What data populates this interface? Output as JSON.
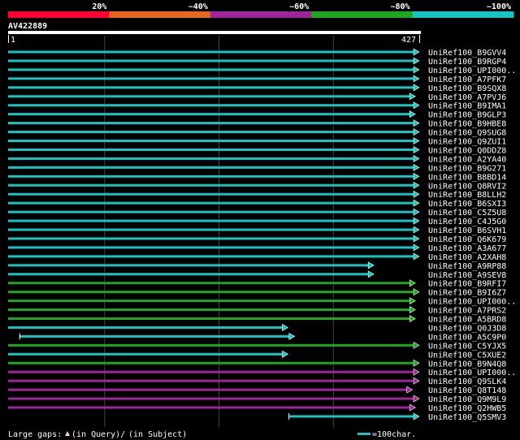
{
  "query": {
    "name": "AV422889",
    "start_label": "1",
    "end_label": "427",
    "length": 427
  },
  "identity_legend": {
    "ticks": [
      "20%",
      "~40%",
      "~60%",
      "~80%",
      "~100%"
    ],
    "colors": [
      "#ff0033",
      "#e8661e",
      "#a0259a",
      "#1fa61f",
      "#17c4c4"
    ]
  },
  "footer": {
    "large_gaps_label": "Large gaps:",
    "in_query_label": "(in Query)/",
    "in_subject_label": "(in Subject)",
    "scale_label": "=100char."
  },
  "chart_data": {
    "type": "alignment",
    "x_range": [
      1,
      427
    ],
    "hits": [
      {
        "name": "UniRef100_B9GVV4",
        "start": 1,
        "end": 427,
        "color": "#17c4c4"
      },
      {
        "name": "UniRef100_B9RGP4",
        "start": 1,
        "end": 427,
        "color": "#17c4c4"
      },
      {
        "name": "UniRef100_UPI000..",
        "start": 1,
        "end": 427,
        "color": "#17c4c4"
      },
      {
        "name": "UniRef100_A7PFK7",
        "start": 1,
        "end": 427,
        "color": "#17c4c4"
      },
      {
        "name": "UniRef100_B9SQX8",
        "start": 1,
        "end": 427,
        "color": "#17c4c4"
      },
      {
        "name": "UniRef100_A7PVJ6",
        "start": 1,
        "end": 423,
        "color": "#17c4c4"
      },
      {
        "name": "UniRef100_B9IMA1",
        "start": 1,
        "end": 427,
        "color": "#17c4c4"
      },
      {
        "name": "UniRef100_B9GLP3",
        "start": 1,
        "end": 423,
        "color": "#17c4c4"
      },
      {
        "name": "UniRef100_B9HBE8",
        "start": 1,
        "end": 427,
        "color": "#17c4c4"
      },
      {
        "name": "UniRef100_Q9SUG8",
        "start": 1,
        "end": 427,
        "color": "#17c4c4"
      },
      {
        "name": "UniRef100_Q9ZUI1",
        "start": 1,
        "end": 427,
        "color": "#17c4c4"
      },
      {
        "name": "UniRef100_Q0DDZ8",
        "start": 1,
        "end": 427,
        "color": "#17c4c4"
      },
      {
        "name": "UniRef100_A2YA40",
        "start": 1,
        "end": 427,
        "color": "#17c4c4"
      },
      {
        "name": "UniRef100_B9G271",
        "start": 1,
        "end": 427,
        "color": "#17c4c4"
      },
      {
        "name": "UniRef100_B8BD14",
        "start": 1,
        "end": 427,
        "color": "#17c4c4"
      },
      {
        "name": "UniRef100_Q8RVI2",
        "start": 1,
        "end": 427,
        "color": "#17c4c4"
      },
      {
        "name": "UniRef100_B8LLH2",
        "start": 1,
        "end": 427,
        "color": "#17c4c4"
      },
      {
        "name": "UniRef100_B6SXI3",
        "start": 1,
        "end": 427,
        "color": "#17c4c4"
      },
      {
        "name": "UniRef100_C5Z5U8",
        "start": 1,
        "end": 427,
        "color": "#17c4c4"
      },
      {
        "name": "UniRef100_C4J5G0",
        "start": 1,
        "end": 427,
        "color": "#17c4c4"
      },
      {
        "name": "UniRef100_B6SVH1",
        "start": 1,
        "end": 427,
        "color": "#17c4c4"
      },
      {
        "name": "UniRef100_Q6K679",
        "start": 1,
        "end": 427,
        "color": "#17c4c4"
      },
      {
        "name": "UniRef100_A3A677",
        "start": 1,
        "end": 427,
        "color": "#17c4c4"
      },
      {
        "name": "UniRef100_A2XAH8",
        "start": 1,
        "end": 427,
        "color": "#17c4c4"
      },
      {
        "name": "UniRef100_A9RP88",
        "start": 1,
        "end": 380,
        "color": "#17c4c4"
      },
      {
        "name": "UniRef100_A9SEV8",
        "start": 1,
        "end": 380,
        "color": "#17c4c4"
      },
      {
        "name": "UniRef100_B9RFI7",
        "start": 1,
        "end": 423,
        "color": "#1fa61f"
      },
      {
        "name": "UniRef100_B9I6Z7",
        "start": 1,
        "end": 427,
        "color": "#1fa61f"
      },
      {
        "name": "UniRef100_UPI000..",
        "start": 1,
        "end": 423,
        "color": "#1fa61f"
      },
      {
        "name": "UniRef100_A7PRS2",
        "start": 1,
        "end": 423,
        "color": "#1fa61f"
      },
      {
        "name": "UniRef100_A5BRD8",
        "start": 1,
        "end": 423,
        "color": "#1fa61f"
      },
      {
        "name": "UniRef100_Q0J3D8",
        "start": 1,
        "end": 291,
        "color": "#17c4c4"
      },
      {
        "name": "UniRef100_A5C9P0",
        "start": 13,
        "end": 298,
        "color": "#17c4c4"
      },
      {
        "name": "UniRef100_C5YJX5",
        "start": 1,
        "end": 427,
        "color": "#1fa61f"
      },
      {
        "name": "UniRef100_C5XUE2",
        "start": 1,
        "end": 291,
        "color": "#17c4c4"
      },
      {
        "name": "UniRef100_B9N4Q8",
        "start": 1,
        "end": 427,
        "color": "#1fa61f"
      },
      {
        "name": "UniRef100_UPI000..",
        "start": 1,
        "end": 427,
        "color": "#a0259a"
      },
      {
        "name": "UniRef100_Q9SLK4",
        "start": 1,
        "end": 427,
        "color": "#a0259a"
      },
      {
        "name": "UniRef100_Q8T148",
        "start": 1,
        "end": 420,
        "color": "#a0259a"
      },
      {
        "name": "UniRef100_Q9M9L9",
        "start": 1,
        "end": 427,
        "color": "#a0259a"
      },
      {
        "name": "UniRef100_Q2HWB5",
        "start": 1,
        "end": 423,
        "color": "#a0259a"
      },
      {
        "name": "UniRef100_Q5SMV3",
        "start": 292,
        "end": 427,
        "color": "#17c4c4"
      }
    ]
  }
}
